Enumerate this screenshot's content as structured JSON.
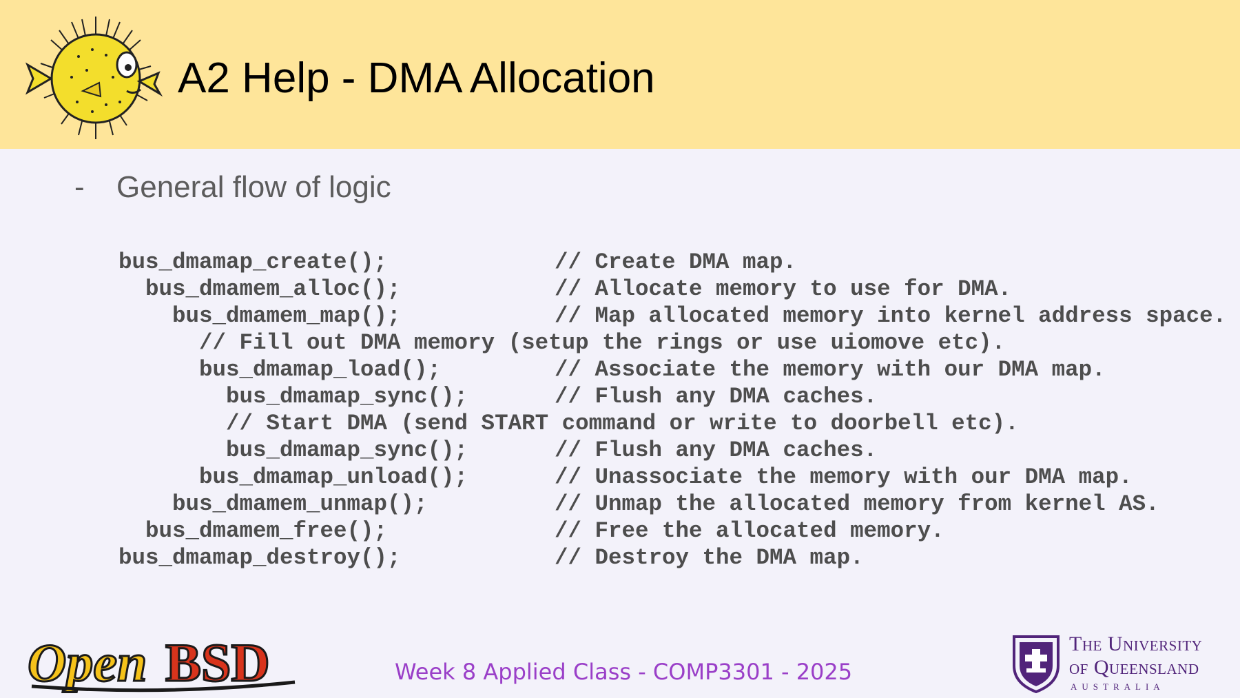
{
  "header": {
    "title": "A2 Help - DMA Allocation",
    "logo_icon": "puffy-pufferfish-icon",
    "background": "#fee59a"
  },
  "bullet": {
    "marker": "-",
    "text": "General flow of logic"
  },
  "code_lines": [
    {
      "indent": 0,
      "call": "bus_dmamap_create();",
      "comment": "// Create DMA map."
    },
    {
      "indent": 2,
      "call": "bus_dmamem_alloc();",
      "comment": "// Allocate memory to use for DMA."
    },
    {
      "indent": 4,
      "call": "bus_dmamem_map();",
      "comment": "// Map allocated memory into kernel address space."
    },
    {
      "indent": 6,
      "full": "// Fill out DMA memory (setup the rings or use uiomove etc)."
    },
    {
      "indent": 6,
      "call": "bus_dmamap_load();",
      "comment": "// Associate the memory with our DMA map."
    },
    {
      "indent": 8,
      "call": "bus_dmamap_sync();",
      "comment": "// Flush any DMA caches."
    },
    {
      "indent": 8,
      "full": "// Start DMA (send START command or write to doorbell etc)."
    },
    {
      "indent": 8,
      "call": "bus_dmamap_sync();",
      "comment": "// Flush any DMA caches."
    },
    {
      "indent": 6,
      "call": "bus_dmamap_unload();",
      "comment": "// Unassociate the memory with our DMA map."
    },
    {
      "indent": 4,
      "call": "bus_dmamem_unmap();",
      "comment": "// Unmap the allocated memory from kernel AS."
    },
    {
      "indent": 2,
      "call": "bus_dmamem_free();",
      "comment": "// Free the allocated memory."
    },
    {
      "indent": 0,
      "call": "bus_dmamap_destroy();",
      "comment": "// Destroy the DMA map."
    }
  ],
  "footer": {
    "text": "Week 8 Applied Class - COMP3301 - 2025",
    "text_color": "#9a3fc8",
    "openbsd_logo": {
      "part1": "Open",
      "part2": "BSD"
    },
    "uq_logo": {
      "line1": "The University",
      "line2": "of Queensland",
      "line3": "AUSTRALIA",
      "color": "#51247a"
    }
  }
}
